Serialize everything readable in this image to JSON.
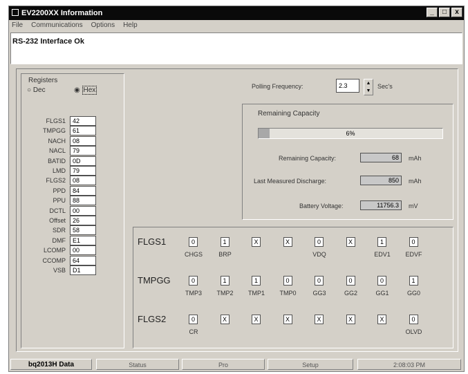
{
  "window": {
    "title": "EV2200XX Information",
    "controls": [
      "_",
      "□",
      "x"
    ]
  },
  "menu": [
    "File",
    "Communications",
    "Options",
    "Help"
  ],
  "status_message": "RS-232 Interface Ok",
  "registers": {
    "title": "Registers",
    "radio_dec": "Dec",
    "radio_hex": "Hex",
    "selected": "Hex",
    "items": [
      {
        "label": "FLGS1",
        "value": "42"
      },
      {
        "label": "TMPGG",
        "value": "61"
      },
      {
        "label": "NACH",
        "value": "08"
      },
      {
        "label": "NACL",
        "value": "79"
      },
      {
        "label": "BATID",
        "value": "0D"
      },
      {
        "label": "LMD",
        "value": "79"
      },
      {
        "label": "FLGS2",
        "value": "08"
      },
      {
        "label": "PPD",
        "value": "84"
      },
      {
        "label": "PPU",
        "value": "88"
      },
      {
        "label": "DCTL",
        "value": "00"
      },
      {
        "label": "Offset",
        "value": "26"
      },
      {
        "label": "SDR",
        "value": "58"
      },
      {
        "label": "DMF",
        "value": "E1"
      },
      {
        "label": "LCOMP",
        "value": "00"
      },
      {
        "label": "CCOMP",
        "value": "64"
      },
      {
        "label": "VSB",
        "value": "D1"
      }
    ]
  },
  "polling": {
    "label": "Polling Frequency:",
    "value": "2.3",
    "unit": "Sec's"
  },
  "capacity": {
    "title": "Remaining Capacity",
    "percent_text": "6%",
    "percent": 0.06,
    "remaining_label": "Remaining Capacity:",
    "remaining_value": "68",
    "remaining_unit": "mAh",
    "lmd_label": "Last Measured Discharge:",
    "lmd_value": "850",
    "lmd_unit": "mAh",
    "voltage_label": "Battery Voltage:",
    "voltage_value": "11756.3",
    "voltage_unit": "mV"
  },
  "flags": [
    {
      "name": "FLGS1",
      "bits": [
        "0",
        "1",
        "X",
        "X",
        "0",
        "X",
        "1",
        "0"
      ],
      "labels": [
        "CHGS",
        "BRP",
        "",
        "",
        "VDQ",
        "",
        "EDV1",
        "EDVF"
      ]
    },
    {
      "name": "TMPGG",
      "bits": [
        "0",
        "1",
        "1",
        "0",
        "0",
        "0",
        "0",
        "1"
      ],
      "labels": [
        "TMP3",
        "TMP2",
        "TMP1",
        "TMP0",
        "GG3",
        "GG2",
        "GG1",
        "GG0"
      ]
    },
    {
      "name": "FLGS2",
      "bits": [
        "0",
        "X",
        "X",
        "X",
        "X",
        "X",
        "X",
        "0"
      ],
      "labels": [
        "CR",
        "",
        "",
        "",
        "",
        "",
        "",
        "OLVD"
      ]
    }
  ],
  "tabs": [
    "bq2013H Data",
    "Status",
    "Pro",
    "Setup"
  ],
  "active_tab": "bq2013H Data",
  "clock": "2:08:03 PM"
}
